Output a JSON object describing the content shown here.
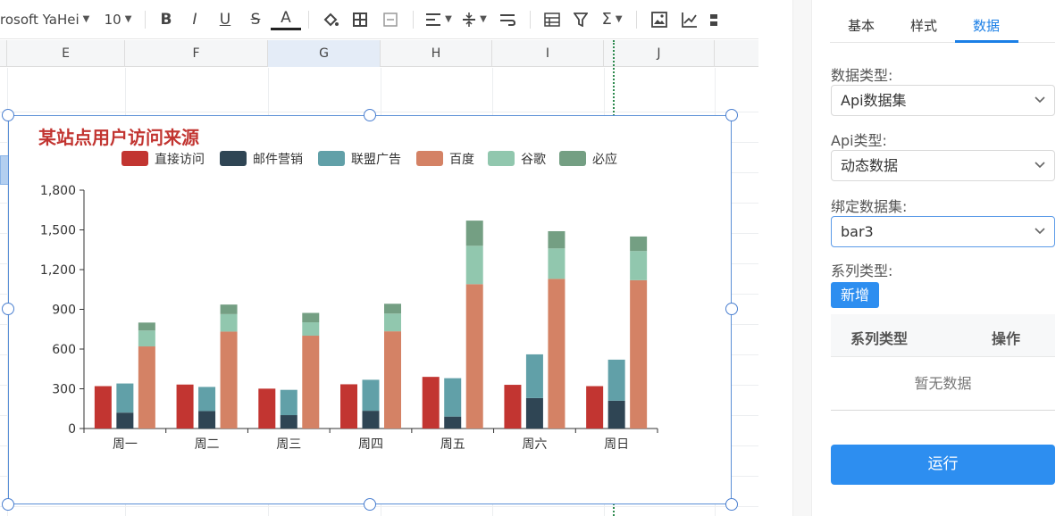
{
  "toolbar": {
    "font_name": "rosoft YaHei",
    "font_size": "10",
    "bold": "B",
    "italic": "I",
    "underline": "U",
    "strike": "S",
    "font_color": "A",
    "sigma": "Σ"
  },
  "columns": [
    "E",
    "F",
    "G",
    "H",
    "I",
    "J"
  ],
  "chart_data": {
    "type": "bar",
    "title": "某站点用户访问来源",
    "categories": [
      "周一",
      "周二",
      "周三",
      "周四",
      "周五",
      "周六",
      "周日"
    ],
    "ylim": [
      0,
      1800
    ],
    "yticks": [
      "0",
      "300",
      "600",
      "900",
      "1,200",
      "1,500",
      "1,800"
    ],
    "series": [
      {
        "name": "直接访问",
        "stack": "a",
        "color": "#c23531",
        "values": [
          320,
          332,
          301,
          334,
          390,
          330,
          320
        ]
      },
      {
        "name": "邮件营销",
        "stack": "b",
        "color": "#2f4554",
        "values": [
          120,
          132,
          101,
          134,
          90,
          230,
          210
        ]
      },
      {
        "name": "联盟广告",
        "stack": "b",
        "color": "#61a0a8",
        "values": [
          220,
          182,
          191,
          234,
          290,
          330,
          310
        ]
      },
      {
        "name": "百度",
        "stack": "c",
        "color": "#d48265",
        "values": [
          620,
          732,
          701,
          734,
          1090,
          1130,
          1120
        ]
      },
      {
        "name": "谷歌",
        "stack": "c",
        "color": "#91c7ae",
        "values": [
          120,
          132,
          101,
          134,
          290,
          230,
          220
        ]
      },
      {
        "name": "必应",
        "stack": "c",
        "color": "#749f83",
        "values": [
          60,
          72,
          71,
          74,
          190,
          130,
          110
        ]
      }
    ],
    "grid": false,
    "legend_position": "top"
  },
  "panel": {
    "tabs": [
      {
        "label": "基本"
      },
      {
        "label": "样式"
      },
      {
        "label": "数据"
      }
    ],
    "data_type_label": "数据类型:",
    "data_type_value": "Api数据集",
    "api_type_label": "Api类型:",
    "api_type_value": "动态数据",
    "dataset_label": "绑定数据集:",
    "dataset_value": "bar3",
    "series_type_label": "系列类型:",
    "add_button": "新增",
    "table_headers": [
      "系列类型",
      "操作"
    ],
    "table_empty": "暂无数据",
    "run_button": "运行"
  }
}
